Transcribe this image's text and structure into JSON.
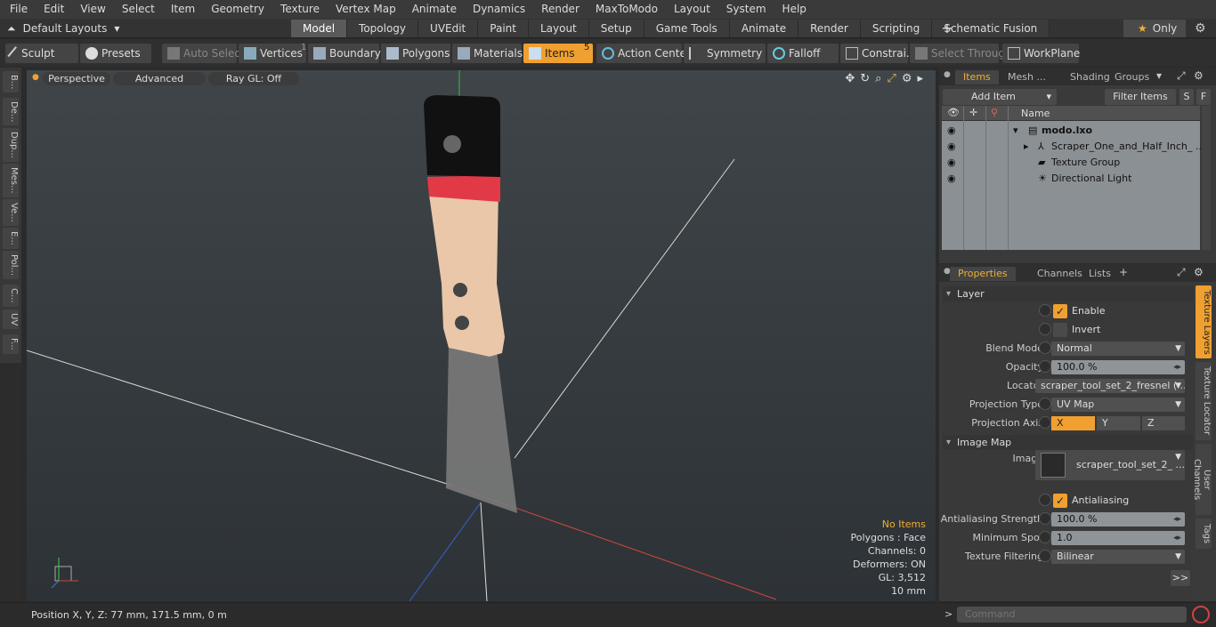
{
  "menu": [
    "File",
    "Edit",
    "View",
    "Select",
    "Item",
    "Geometry",
    "Texture",
    "Vertex Map",
    "Animate",
    "Dynamics",
    "Render",
    "MaxToModo",
    "Layout",
    "System",
    "Help"
  ],
  "layout_selector": "Default Layouts",
  "mode_tabs": [
    "Model",
    "Topology",
    "UVEdit",
    "Paint",
    "Layout",
    "Setup",
    "Game Tools",
    "Animate",
    "Render",
    "Scripting",
    "Schematic Fusion"
  ],
  "only_label": "Only",
  "tools": {
    "sculpt": "Sculpt",
    "presets": "Presets",
    "auto_select": "Auto Select",
    "vertices": "Vertices",
    "vertices_count": "1",
    "boundary": "Boundary",
    "polygons": "Polygons",
    "materials": "Materials",
    "items": "Items",
    "items_count": "5",
    "action_center": "Action Center",
    "symmetry": "Symmetry",
    "falloff": "Falloff",
    "constraints": "Constrai...",
    "select_through": "Select Through",
    "workplane": "WorkPlane"
  },
  "left_tabs": [
    "B...",
    "De...",
    "Dup...",
    "Mes...",
    "Ve...",
    "E...",
    "Pol...",
    "C...",
    "UV",
    "F..."
  ],
  "viewport": {
    "view": "Perspective",
    "shading": "Advanced",
    "raygl": "Ray GL: Off",
    "stats": {
      "selection": "No Items",
      "polygons": "Polygons : Face",
      "channels": "Channels: 0",
      "deformers": "Deformers: ON",
      "gl": "GL: 3,512",
      "scale": "10 mm"
    }
  },
  "status": "Position X, Y, Z:   77 mm, 171.5 mm, 0 m",
  "items_panel": {
    "tabs": [
      "Items",
      "Mesh ...",
      "Shading",
      "Groups"
    ],
    "add_item": "Add Item",
    "filter": "Filter Items",
    "s_btn": "S",
    "f_btn": "F",
    "col_name": "Name",
    "rows": [
      "modo.lxo",
      "Scraper_One_and_Half_Inch_ ...",
      "Texture Group",
      "Directional Light"
    ]
  },
  "properties_panel": {
    "tabs": [
      "Properties",
      "Channels",
      "Lists"
    ],
    "layer_section": "Layer",
    "enable": "Enable",
    "invert": "Invert",
    "blend_mode_label": "Blend Mode",
    "blend_mode": "Normal",
    "opacity_label": "Opacity",
    "opacity": "100.0 %",
    "locator_label": "Locator",
    "locator": "scraper_tool_set_2_fresnel ( ...",
    "projection_type_label": "Projection Type",
    "projection_type": "UV Map",
    "projection_axis_label": "Projection Axis",
    "axis_x": "X",
    "axis_y": "Y",
    "axis_z": "Z",
    "image_map_section": "Image Map",
    "image_label": "Image",
    "image": "scraper_tool_set_2_ ...",
    "antialiasing": "Antialiasing",
    "aa_strength_label": "Antialiasing Strength",
    "aa_strength": "100.0 %",
    "min_spot_label": "Minimum Spot",
    "min_spot": "1.0",
    "tex_filter_label": "Texture Filtering",
    "tex_filter": "Bilinear",
    "more": ">>",
    "side_tabs": [
      "Texture Layers",
      "Texture Locator",
      "User Channels",
      "Tags"
    ]
  },
  "command_placeholder": "Command"
}
